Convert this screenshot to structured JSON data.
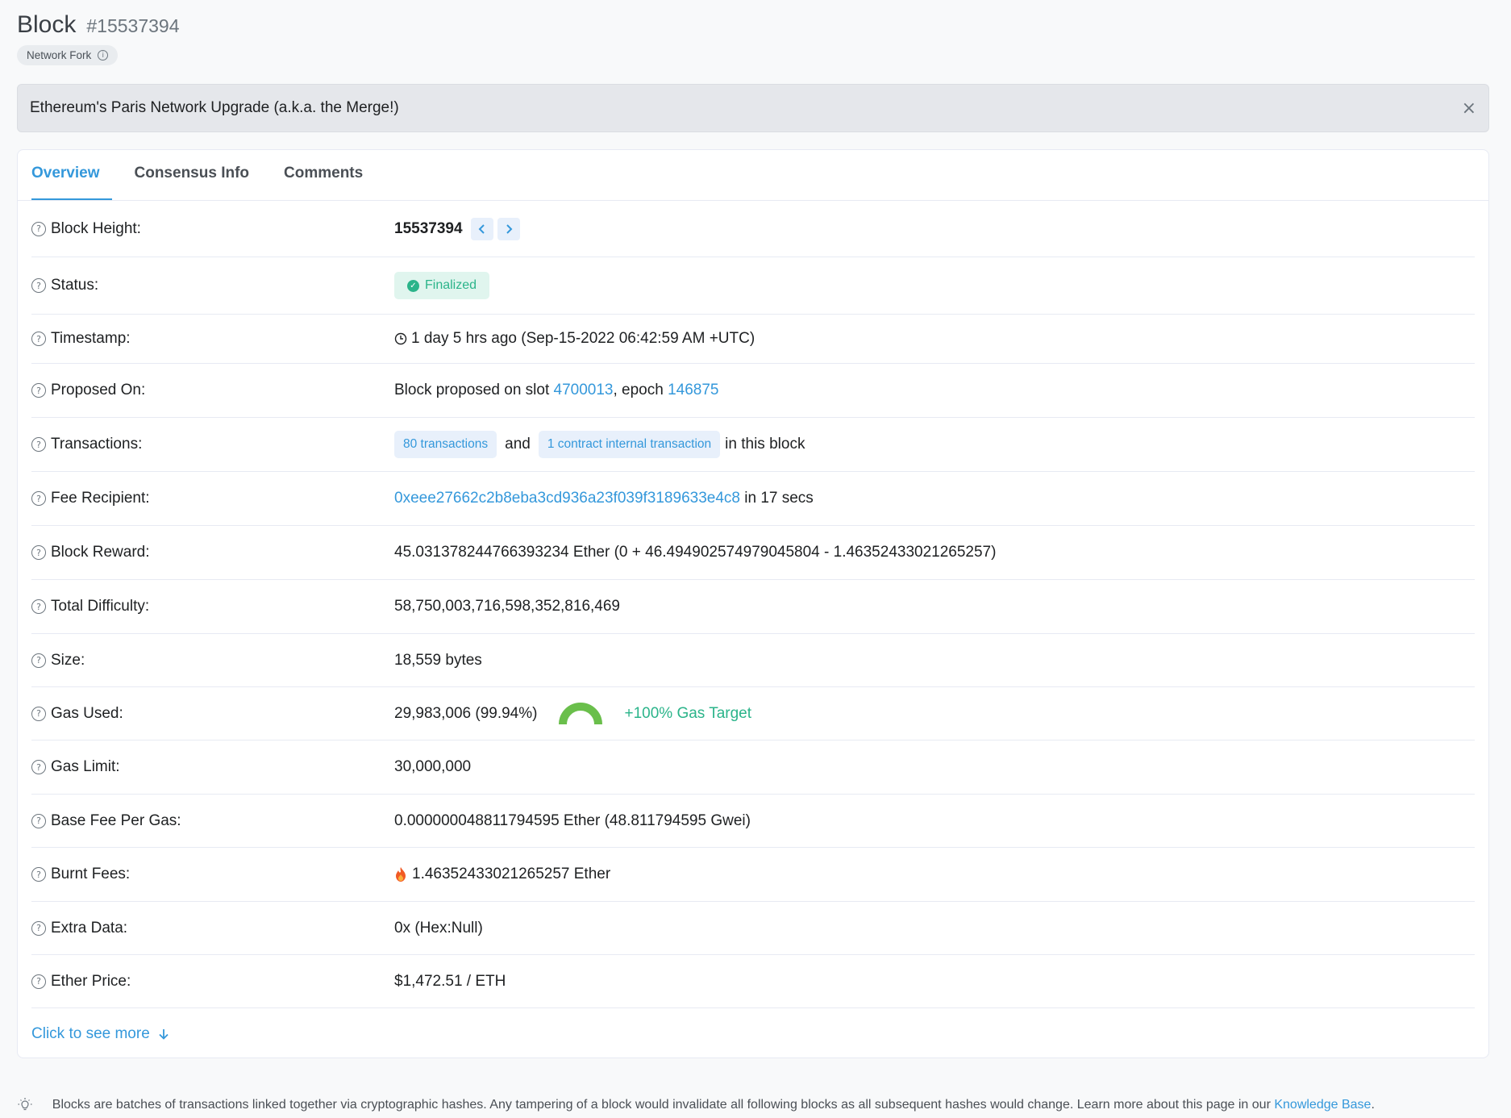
{
  "header": {
    "title": "Block",
    "block_number": "#15537394",
    "badge": "Network Fork",
    "badge_icon": "info-icon"
  },
  "banner": {
    "text": "Ethereum's Paris Network Upgrade (a.k.a. the Merge!)",
    "close": "×"
  },
  "tabs": [
    {
      "label": "Overview",
      "active": true
    },
    {
      "label": "Consensus Info",
      "active": false
    },
    {
      "label": "Comments",
      "active": false
    }
  ],
  "rows": {
    "block_height": {
      "label": "Block Height:",
      "value": "15537394"
    },
    "status": {
      "label": "Status:",
      "value": "Finalized"
    },
    "timestamp": {
      "label": "Timestamp:",
      "value": "1 day 5 hrs ago (Sep-15-2022 06:42:59 AM +UTC)"
    },
    "proposed_on": {
      "label": "Proposed On:",
      "prefix": "Block proposed on slot ",
      "slot": "4700013",
      "mid": ", epoch ",
      "epoch": "146875"
    },
    "transactions": {
      "label": "Transactions:",
      "tx": "80 transactions",
      "and": "and",
      "internal": "1 contract internal transaction",
      "suffix": "in this block"
    },
    "fee_recipient": {
      "label": "Fee Recipient:",
      "address": "0xeee27662c2b8eba3cd936a23f039f3189633e4c8",
      "suffix": " in 17 secs"
    },
    "block_reward": {
      "label": "Block Reward:",
      "value": "45.031378244766393234 Ether (0 + 46.494902574979045804 - 1.46352433021265257)"
    },
    "total_difficulty": {
      "label": "Total Difficulty:",
      "value": "58,750,003,716,598,352,816,469"
    },
    "size": {
      "label": "Size:",
      "value": "18,559 bytes"
    },
    "gas_used": {
      "label": "Gas Used:",
      "value": "29,983,006 (99.94%)",
      "gauge_fraction": 0.9994,
      "target": "+100% Gas Target"
    },
    "gas_limit": {
      "label": "Gas Limit:",
      "value": "30,000,000"
    },
    "base_fee": {
      "label": "Base Fee Per Gas:",
      "value": "0.000000048811794595 Ether (48.811794595 Gwei)"
    },
    "burnt_fees": {
      "label": "Burnt Fees:",
      "value": "1.46352433021265257 Ether"
    },
    "extra_data": {
      "label": "Extra Data:",
      "value": "0x (Hex:Null)"
    },
    "ether_price": {
      "label": "Ether Price:",
      "value": "$1,472.51 / ETH"
    }
  },
  "see_more": "Click to see more",
  "footer": {
    "text": "Blocks are batches of transactions linked together via cryptographic hashes. Any tampering of a block would invalidate all following blocks as all subsequent hashes would change. Learn more about this page in our ",
    "link": "Knowledge Base",
    "end": "."
  }
}
